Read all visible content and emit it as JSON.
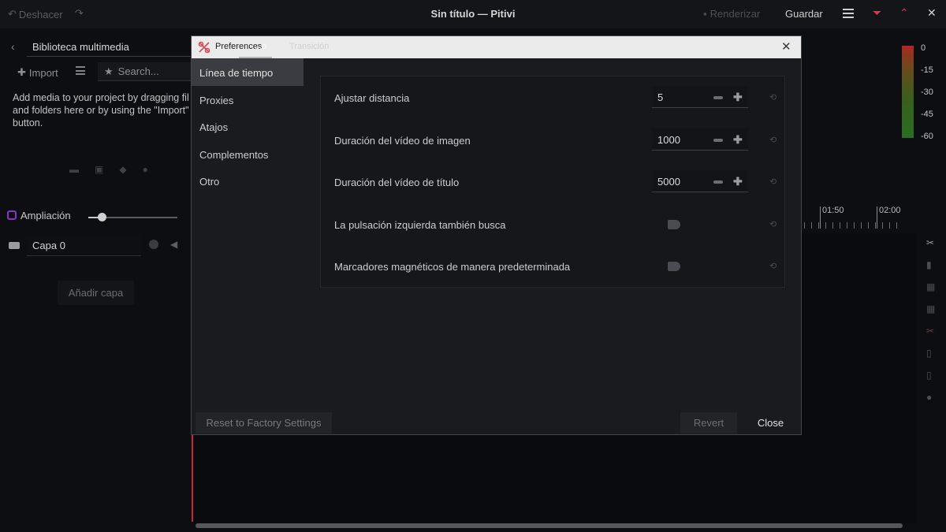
{
  "header": {
    "undo_label": "Deshacer",
    "title": "Sin título — Pitivi",
    "render_label": "Renderizar",
    "save_label": "Guardar"
  },
  "library": {
    "title": "Biblioteca multimedia",
    "import_label": "Import",
    "search_placeholder": "Search...",
    "hint_lines": [
      "Add media to your project by dragging fil",
      "and folders here or by using the \"Import\"",
      "button."
    ]
  },
  "timeline": {
    "zoom_label": "Ampliación",
    "zoom_level": 0.15,
    "layer_name": "Capa 0",
    "add_layer_label": "Añadir capa",
    "ruler_ticks": [
      "01:50",
      "02:00"
    ],
    "meter_labels": [
      "0",
      "-15",
      "-30",
      "-45",
      "-60"
    ]
  },
  "dialog": {
    "title": "Preferences",
    "behind_tab_partial": "...o",
    "behind_tab_2": "Transición",
    "sidebar": [
      "Línea de tiempo",
      "Proxies",
      "Atajos",
      "Complementos",
      "Otro"
    ],
    "active_sidebar_index": 0,
    "settings": [
      {
        "label": "Ajustar distancia",
        "type": "spin",
        "value": "5"
      },
      {
        "label": "Duración del vídeo de imagen",
        "type": "spin",
        "value": "1000"
      },
      {
        "label": "Duración del vídeo de título",
        "type": "spin",
        "value": "5000"
      },
      {
        "label": "La pulsación izquierda también busca",
        "type": "toggle",
        "value": false
      },
      {
        "label": "Marcadores magnéticos de manera predeterminada",
        "type": "toggle",
        "value": false
      }
    ],
    "buttons": {
      "factory": "Reset to Factory Settings",
      "revert": "Revert",
      "close": "Close"
    }
  },
  "colors": {
    "accent": "#d23a50",
    "playhead": "#c8283a",
    "zoom_icon": "#8a35c4"
  }
}
